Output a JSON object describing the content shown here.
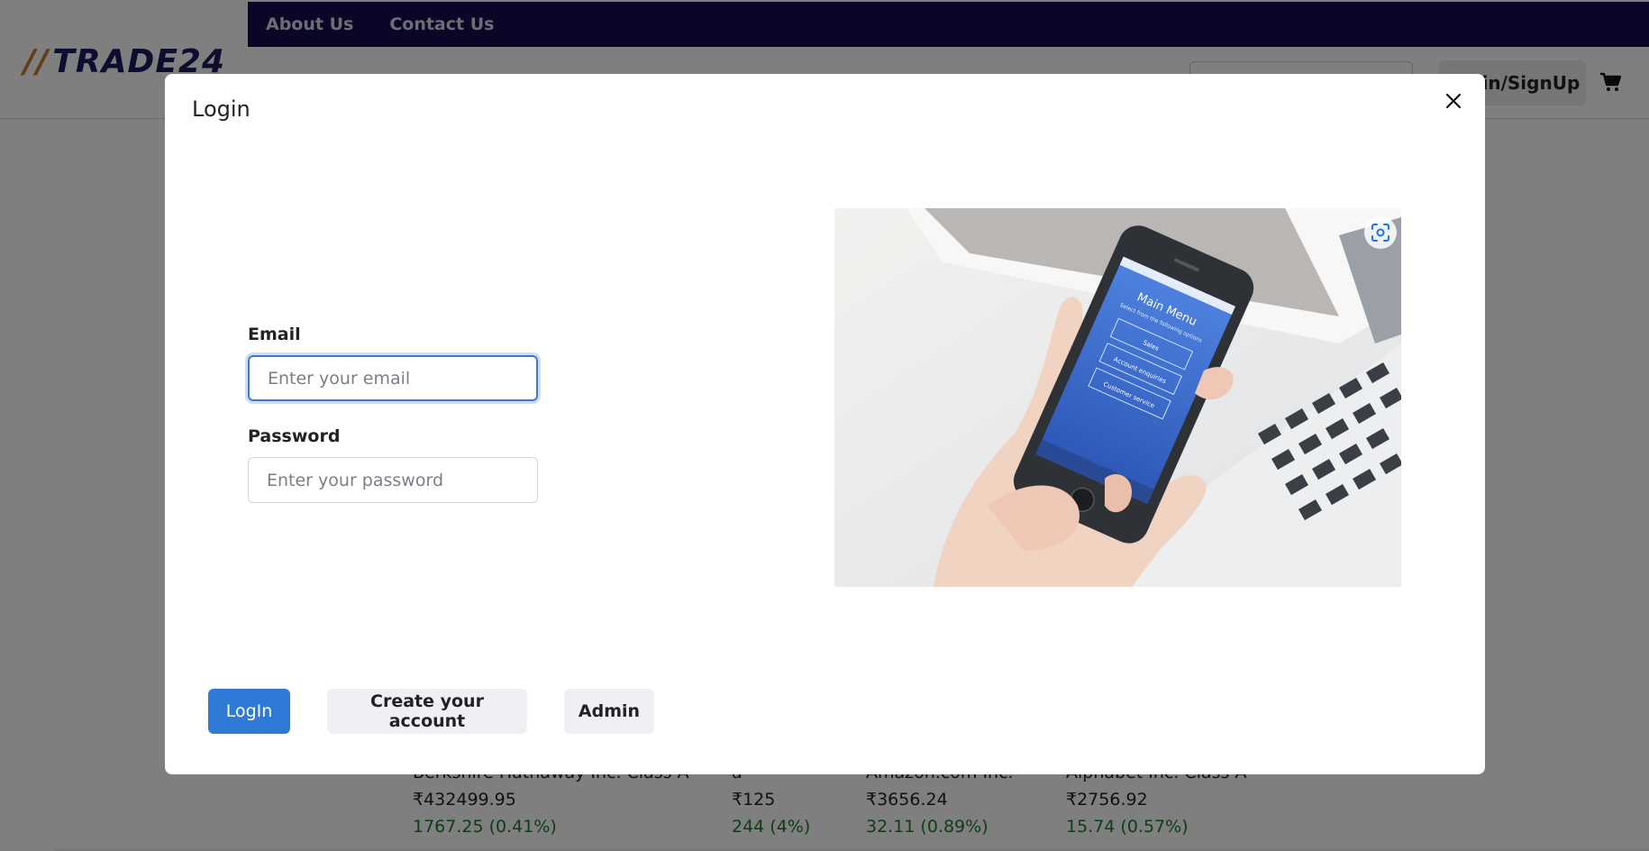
{
  "nav": {
    "about": "About Us",
    "contact": "Contact Us"
  },
  "brand": {
    "slashes": "//",
    "name": "TRADE24"
  },
  "header": {
    "login_signup": "Login/SignUp"
  },
  "stocks": [
    {
      "name": "Berkshire Hathaway Inc. Class A",
      "price": "₹432499.95",
      "change": "1767.25 (0.41%)"
    },
    {
      "name": "a",
      "price": "₹125",
      "change": "244 (4%)"
    },
    {
      "name": "Amazon.com Inc.",
      "price": "₹3656.24",
      "change": "32.11 (0.89%)"
    },
    {
      "name": "Alphabet Inc. Class A",
      "price": "₹2756.92",
      "change": "15.74 (0.57%)"
    }
  ],
  "modal": {
    "title": "Login",
    "email_label": "Email",
    "email_placeholder": "Enter your email",
    "password_label": "Password",
    "password_placeholder": "Enter your password",
    "login_button": "LogIn",
    "create_button": "Create your account",
    "admin_button": "Admin",
    "phone_screen": {
      "title": "Main Menu",
      "subtitle": "Select from the following options",
      "items": [
        "Sales",
        "Account enquiries",
        "Customer service"
      ]
    }
  },
  "colors": {
    "nav_bg": "#1a0b4f",
    "primary": "#2f7ad6",
    "positive": "#1c7a2a",
    "logo_accent": "#c47a2c"
  }
}
